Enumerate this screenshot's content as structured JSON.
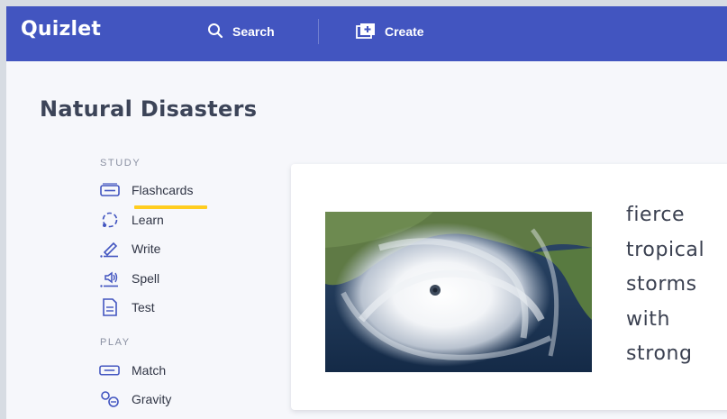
{
  "header": {
    "logo": "Quizlet",
    "search_label": "Search",
    "create_label": "Create",
    "background": "#4255c0"
  },
  "set": {
    "title": "Natural Disasters"
  },
  "sidebar": {
    "study_label": "STUDY",
    "study_modes": [
      {
        "label": "Flashcards",
        "icon": "flashcards-icon",
        "active": true
      },
      {
        "label": "Learn",
        "icon": "learn-icon"
      },
      {
        "label": "Write",
        "icon": "write-icon"
      },
      {
        "label": "Spell",
        "icon": "spell-icon"
      },
      {
        "label": "Test",
        "icon": "test-icon"
      }
    ],
    "play_label": "PLAY",
    "play_modes": [
      {
        "label": "Match",
        "icon": "match-icon"
      },
      {
        "label": "Gravity",
        "icon": "gravity-icon"
      }
    ],
    "active_underline_color": "#ffcd1f"
  },
  "card": {
    "image": "hurricane-satellite-image",
    "definition_lines": [
      "fierce",
      "tropical",
      "storms",
      "with",
      "strong"
    ]
  }
}
